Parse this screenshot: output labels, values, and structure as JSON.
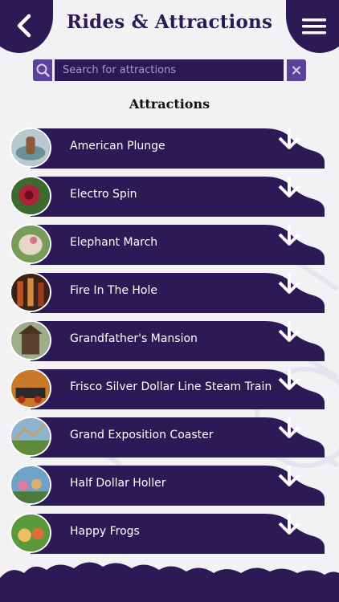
{
  "header": {
    "title": "Rides & Attractions",
    "back_icon": "chevron-left-icon",
    "menu_icon": "hamburger-menu-icon"
  },
  "search": {
    "placeholder": "Search for attractions",
    "search_icon": "search-icon",
    "clear_icon": "close-icon"
  },
  "section": {
    "title": "Attractions"
  },
  "attractions": [
    {
      "label": "American Plunge"
    },
    {
      "label": "Electro Spin"
    },
    {
      "label": "Elephant March"
    },
    {
      "label": "Fire In The Hole"
    },
    {
      "label": "Grandfather's Mansion"
    },
    {
      "label": "Frisco Silver Dollar Line Steam Train"
    },
    {
      "label": "Grand Exposition Coaster"
    },
    {
      "label": "Half Dollar Holler"
    },
    {
      "label": "Happy Frogs"
    }
  ],
  "colors": {
    "primary": "#2b1a55",
    "accent": "#5a4297",
    "background": "#f2f1f4"
  }
}
